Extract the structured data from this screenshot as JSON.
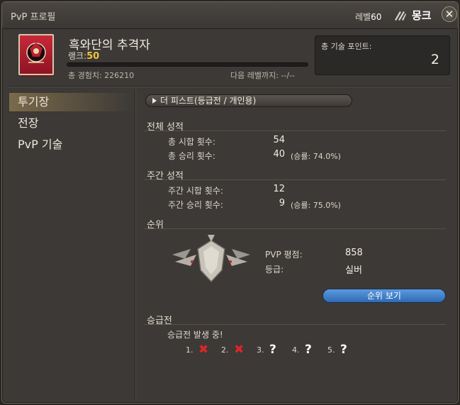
{
  "window": {
    "title": "PvP 프로필",
    "level_label": "레벨",
    "level_value": "60",
    "job_icon": "monk-claws-icon",
    "job_name": "몽크",
    "close_symbol": "✕"
  },
  "profile": {
    "title_name": "흑와단의 추격자",
    "rank_label": "랭크:",
    "rank_value": "50",
    "total_xp": "총 경험치: 226210",
    "next_level": "다음 레벨까지: --/--",
    "xp_fraction": 0,
    "emblem_icon": "grand-company-emblem-icon",
    "emblem_color": "#c8283a"
  },
  "tech_points": {
    "label": "총 기술 포인트:",
    "value": "2"
  },
  "nav": {
    "items": [
      {
        "label": "투기장",
        "active": true
      },
      {
        "label": "전장",
        "active": false
      },
      {
        "label": "PvP 기술",
        "active": false
      }
    ]
  },
  "content": {
    "mode_dropdown": "더 피스트(등급전 / 개인용)",
    "overall": {
      "title": "전체 성적",
      "matches_label": "총 시합 횟수:",
      "matches_value": "54",
      "wins_label": "총 승리 횟수:",
      "wins_value": "40",
      "wins_rate": "(승률: 74.0%)"
    },
    "weekly": {
      "title": "주간 성적",
      "matches_label": "주간 시합 횟수:",
      "matches_value": "12",
      "wins_label": "주간 승리 횟수:",
      "wins_value": "9",
      "wins_rate": "(승률: 75.0%)"
    },
    "ranking": {
      "title": "순위",
      "rating_label": "PVP 평점:",
      "rating_value": "858",
      "tier_label": "등급:",
      "tier_value": "실버",
      "tier_icon": "silver-tier-emblem-icon",
      "button_label": "순위 보기"
    },
    "promotion": {
      "title": "승급전",
      "status": "승급전 발생 중!",
      "slots": [
        {
          "num": "1.",
          "mark": "✖",
          "state": "fail"
        },
        {
          "num": "2.",
          "mark": "✖",
          "state": "fail"
        },
        {
          "num": "3.",
          "mark": "?",
          "state": "unknown"
        },
        {
          "num": "4.",
          "mark": "?",
          "state": "unknown"
        },
        {
          "num": "5.",
          "mark": "?",
          "state": "unknown"
        }
      ]
    }
  }
}
